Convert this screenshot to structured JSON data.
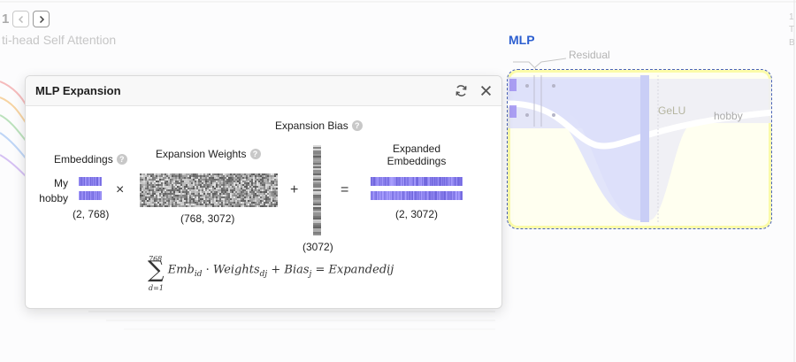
{
  "background": {
    "page_number": "1",
    "prev_icon": "chevron-left-icon",
    "next_icon": "chevron-right-icon",
    "section_title": "ti-head Self Attention",
    "mlp_heading": "MLP",
    "residual_label": "Residual",
    "gelu_label": "GeLU",
    "hobby_label": "hobby",
    "right_edge_chars": [
      "1",
      "T",
      "B"
    ]
  },
  "panel": {
    "title": "MLP Expansion",
    "refresh_icon": "refresh-icon",
    "close_icon": "close-icon",
    "embeddings": {
      "label": "Embeddings",
      "tokens": [
        "My",
        "hobby"
      ],
      "shape": "(2, 768)"
    },
    "weights": {
      "label": "Expansion Weights",
      "shape": "(768, 3072)"
    },
    "bias": {
      "label": "Expansion Bias",
      "shape": "(3072)"
    },
    "expanded": {
      "label_line1": "Expanded",
      "label_line2": "Embeddings",
      "shape": "(2, 3072)"
    },
    "operators": {
      "times": "×",
      "plus": "+",
      "equals": "="
    },
    "formula": {
      "upper": "768",
      "lower": "d=1",
      "emb": "Emb",
      "emb_sub": "id",
      "weights": "Weights",
      "weights_sub": "dj",
      "bias": "Bias",
      "bias_sub": "j",
      "result": "Expandedij"
    },
    "colors": {
      "accent": "#2d5fd0",
      "embedding": "#9b8cf0",
      "weights": "#8c8c8c"
    }
  }
}
